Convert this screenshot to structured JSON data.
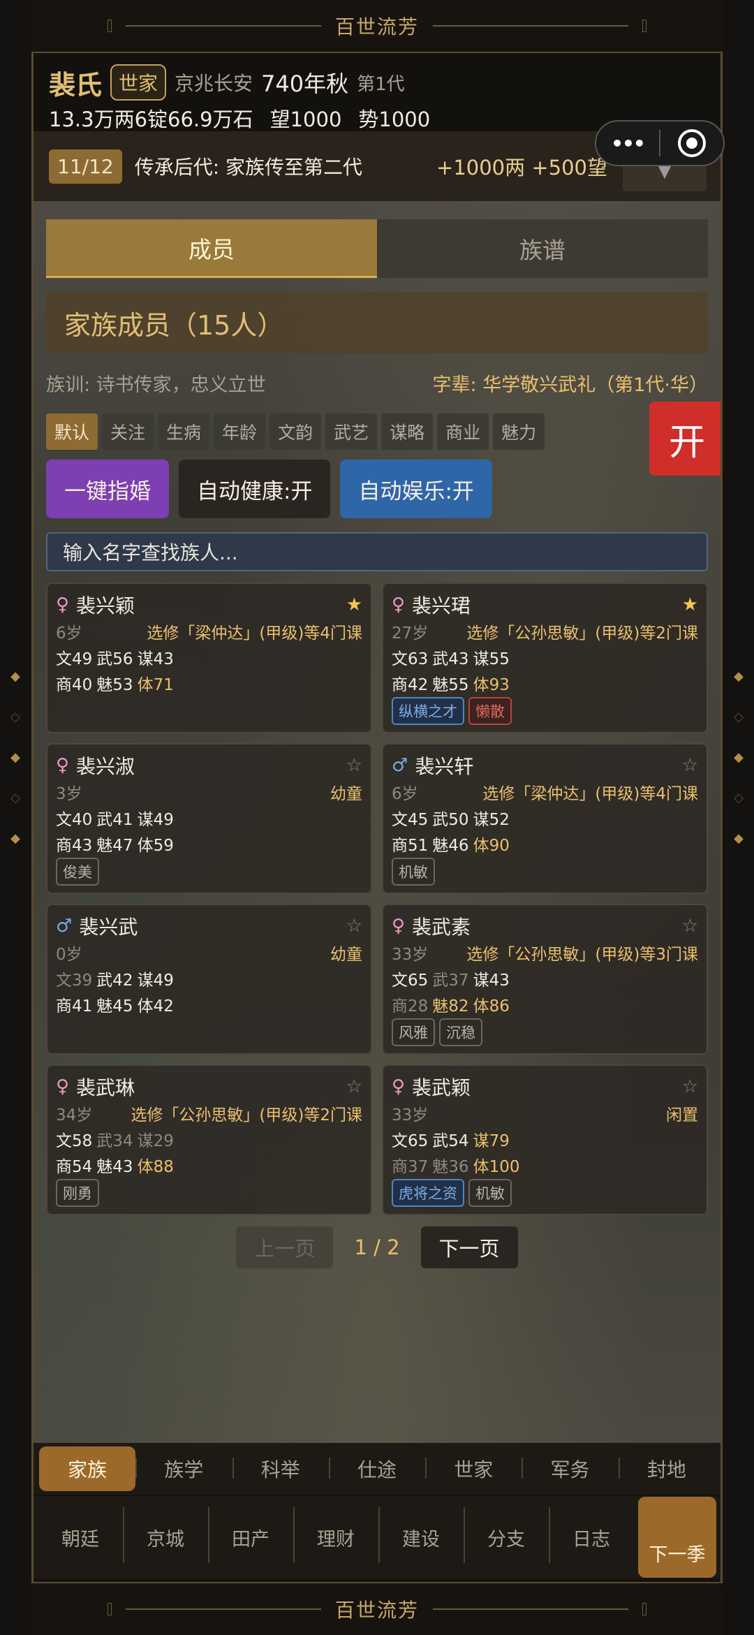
{
  "banner_title": "百世流芳",
  "header": {
    "clan": "裴氏",
    "rank_badge": "世家",
    "location": "京兆长安",
    "year": "740年秋",
    "generation": "第1代",
    "wealth": "13.3万两6锭66.9万石",
    "prestige": "望1000",
    "power": "势1000"
  },
  "quest": {
    "progress": "11/12",
    "text": "传承后代: 家族传至第二代",
    "reward": "+1000两 +500望",
    "dropdown": "▼"
  },
  "tabs": [
    "成员",
    "族谱"
  ],
  "section_title": "家族成员（15人）",
  "motto": "族训: 诗书传家，忠义立世",
  "zibei": "字辈: 华学敬兴武礼（第1代·华）",
  "filters": [
    "默认",
    "关注",
    "生病",
    "年龄",
    "文韵",
    "武艺",
    "谋略",
    "商业",
    "魅力"
  ],
  "open_button": "开",
  "actions": {
    "marriage": "一键指婚",
    "auto_health": "自动健康:开",
    "auto_fun": "自动娱乐:开"
  },
  "search": {
    "placeholder": "输入名字查找族人..."
  },
  "members": [
    {
      "sex": "♀",
      "name": "裴兴颖",
      "star": "★",
      "age": "6岁",
      "status": "选修「梁仲达」(甲级)等4门课",
      "wen": "文49",
      "wu": "武56",
      "mou": "谋43",
      "shang": "商40",
      "mei": "魅53",
      "ti": "体71",
      "tags": []
    },
    {
      "sex": "♀",
      "name": "裴兴珺",
      "star": "★",
      "age": "27岁",
      "status": "选修「公孙思敏」(甲级)等2门课",
      "wen": "文63",
      "wu": "武43",
      "mou": "谋55",
      "shang": "商42",
      "mei": "魅55",
      "ti": "体93",
      "tags": [
        "纵横之才",
        "懒散"
      ]
    },
    {
      "sex": "♀",
      "name": "裴兴淑",
      "star": "☆",
      "age": "3岁",
      "status": "幼童",
      "wen": "文40",
      "wu": "武41",
      "mou": "谋49",
      "shang": "商43",
      "mei": "魅47",
      "ti": "体59",
      "tags": [
        "俊美"
      ]
    },
    {
      "sex": "♂",
      "name": "裴兴轩",
      "star": "☆",
      "age": "6岁",
      "status": "选修「梁仲达」(甲级)等4门课",
      "wen": "文45",
      "wu": "武50",
      "mou": "谋52",
      "shang": "商51",
      "mei": "魅46",
      "ti": "体90",
      "tags": [
        "机敏"
      ]
    },
    {
      "sex": "♂",
      "name": "裴兴武",
      "star": "☆",
      "age": "0岁",
      "status": "幼童",
      "wen": "文39",
      "wu": "武42",
      "mou": "谋49",
      "shang": "商41",
      "mei": "魅45",
      "ti": "体42",
      "tags": []
    },
    {
      "sex": "♀",
      "name": "裴武素",
      "star": "☆",
      "age": "33岁",
      "status": "选修「公孙思敏」(甲级)等3门课",
      "wen": "文65",
      "wu": "武37",
      "mou": "谋43",
      "shang": "商28",
      "mei": "魅82",
      "ti": "体86",
      "tags": [
        "风雅",
        "沉稳"
      ]
    },
    {
      "sex": "♀",
      "name": "裴武琳",
      "star": "☆",
      "age": "34岁",
      "status": "选修「公孙思敏」(甲级)等2门课",
      "wen": "文58",
      "wu": "武34",
      "mou": "谋29",
      "shang": "商54",
      "mei": "魅43",
      "ti": "体88",
      "tags": [
        "刚勇"
      ]
    },
    {
      "sex": "♀",
      "name": "裴武颖",
      "star": "☆",
      "age": "33岁",
      "status": "闲置",
      "wen": "文65",
      "wu": "武54",
      "mou": "谋79",
      "shang": "商37",
      "mei": "魅36",
      "ti": "体100",
      "tags": [
        "虎将之资",
        "机敏"
      ]
    }
  ],
  "pager": {
    "prev": "上一页",
    "page": "1 / 2",
    "next": "下一页"
  },
  "nav1": [
    "家族",
    "族学",
    "科举",
    "仕途",
    "世家",
    "军务",
    "封地"
  ],
  "nav2": [
    "朝廷",
    "京城",
    "田产",
    "理财",
    "建设",
    "分支",
    "日志"
  ],
  "next_season": "下一季",
  "colors": {
    "gold": "#e3be74",
    "accent_brown": "#9b6a2b",
    "purple": "#7d3fb1",
    "blue": "#2f66a8",
    "red": "#cf2e2a"
  }
}
